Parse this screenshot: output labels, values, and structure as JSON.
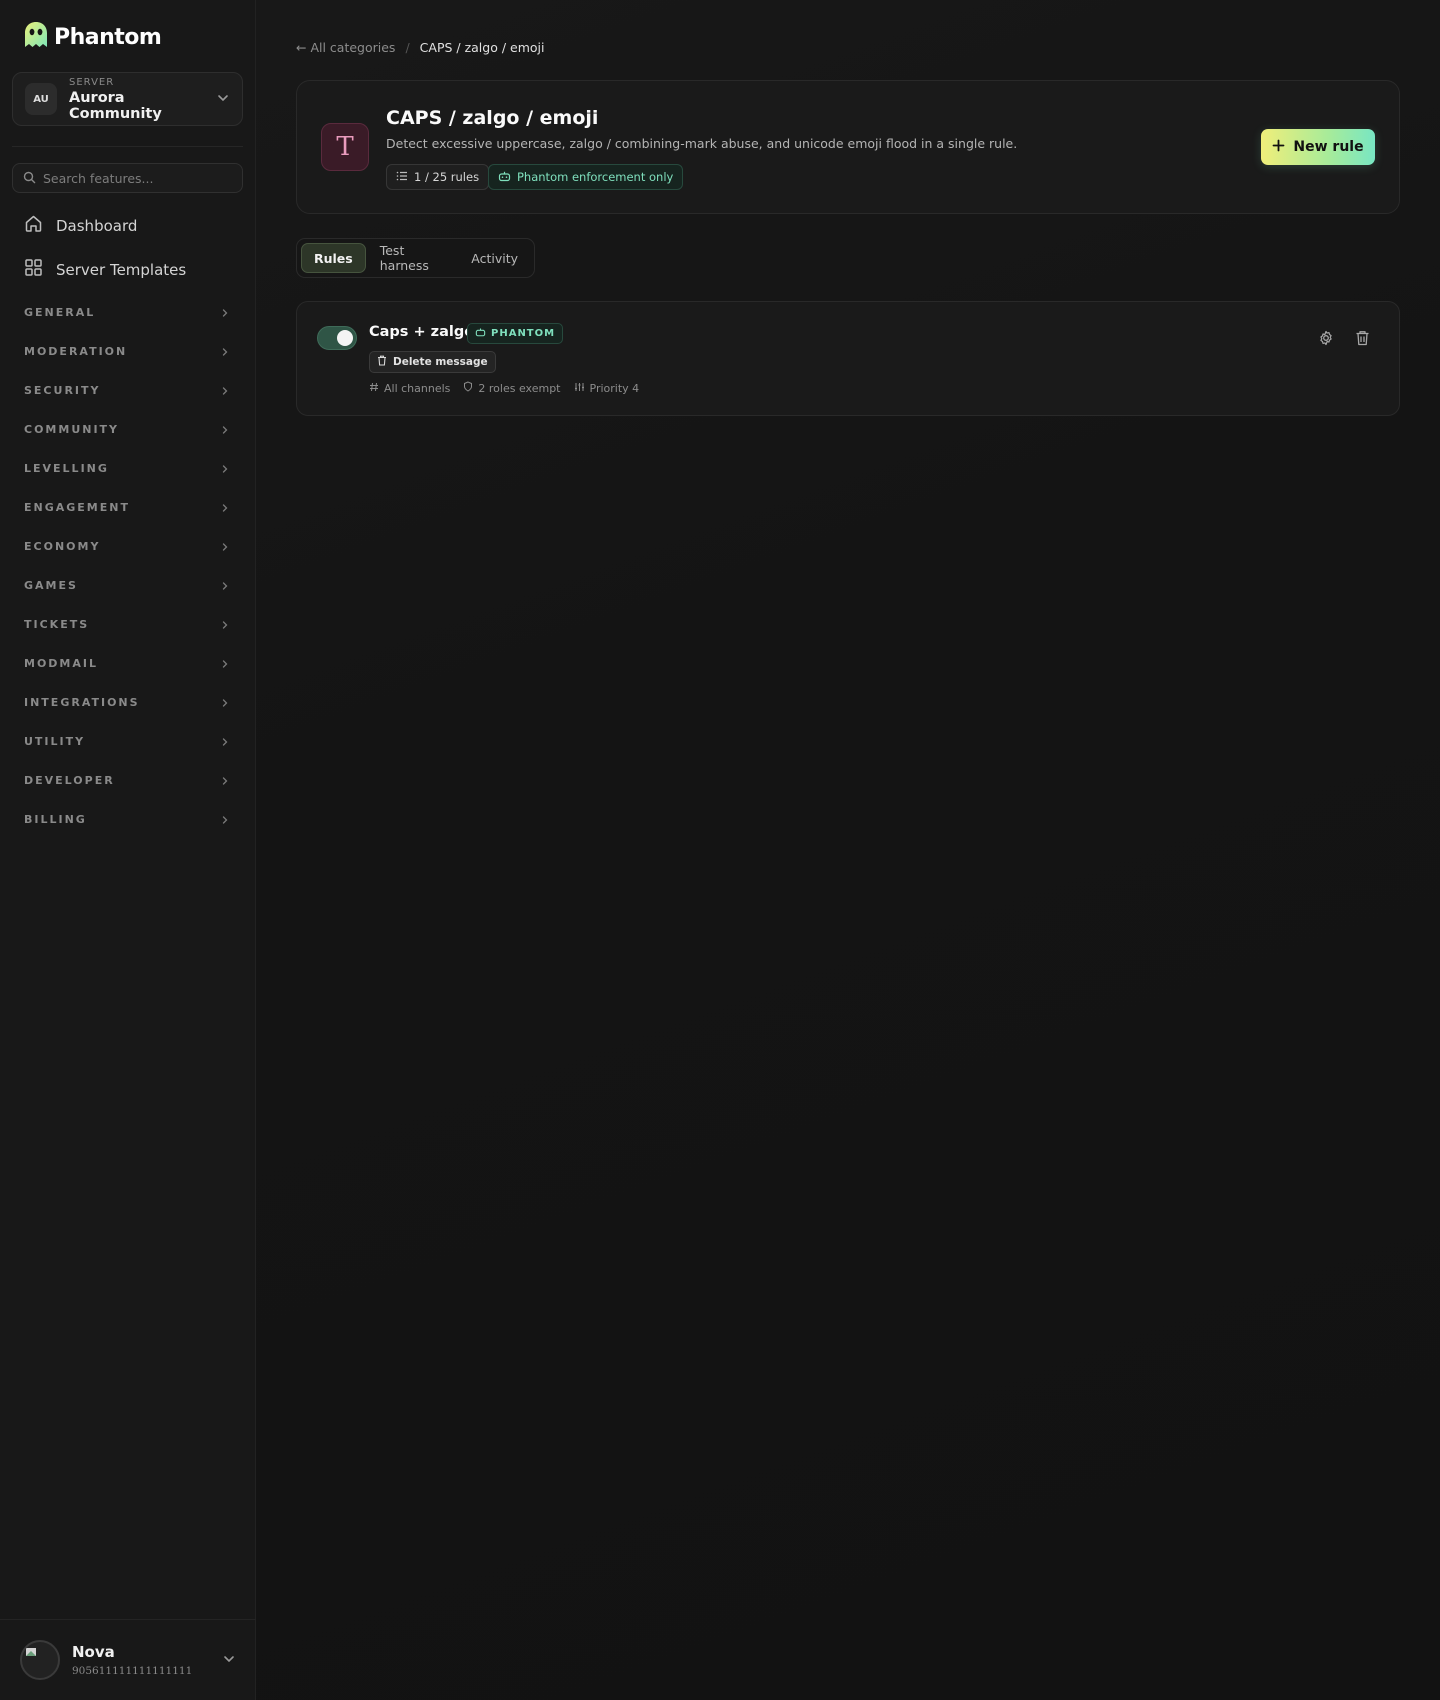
{
  "brand": {
    "name": "Phantom"
  },
  "server": {
    "caption": "SERVER",
    "initials": "AU",
    "name": "Aurora Community"
  },
  "search": {
    "placeholder": "Search features..."
  },
  "nav": {
    "dashboard": "Dashboard",
    "templates": "Server Templates"
  },
  "sections": [
    "GENERAL",
    "MODERATION",
    "SECURITY",
    "COMMUNITY",
    "LEVELLING",
    "ENGAGEMENT",
    "ECONOMY",
    "GAMES",
    "TICKETS",
    "MODMAIL",
    "INTEGRATIONS",
    "UTILITY",
    "DEVELOPER",
    "BILLING"
  ],
  "user": {
    "name": "Nova",
    "id": "905611111111111111"
  },
  "breadcrumb": {
    "back": "← All categories",
    "separator": "/",
    "current": "CAPS / zalgo / emoji"
  },
  "category": {
    "icon_letter": "T",
    "title": "CAPS / zalgo / emoji",
    "description": "Detect excessive uppercase, zalgo / combining-mark abuse, and unicode emoji flood in a single rule.",
    "rule_count": "1 / 25 rules",
    "enforcement": "Phantom enforcement only",
    "new_rule_label": "New rule"
  },
  "tabs": [
    "Rules",
    "Test harness",
    "Activity"
  ],
  "active_tab": "Rules",
  "rules": [
    {
      "enabled": true,
      "name": "Caps + zalgo",
      "badge": "PHANTOM",
      "action": "Delete message",
      "channels": "All channels",
      "exempt": "2 roles exempt",
      "priority": "Priority 4"
    }
  ],
  "colors": {
    "accent_green": "#7fe0bd",
    "button_gradient": [
      "#f0ee7a",
      "#78e6c3"
    ],
    "icon_pink": "#ea9bbd"
  }
}
